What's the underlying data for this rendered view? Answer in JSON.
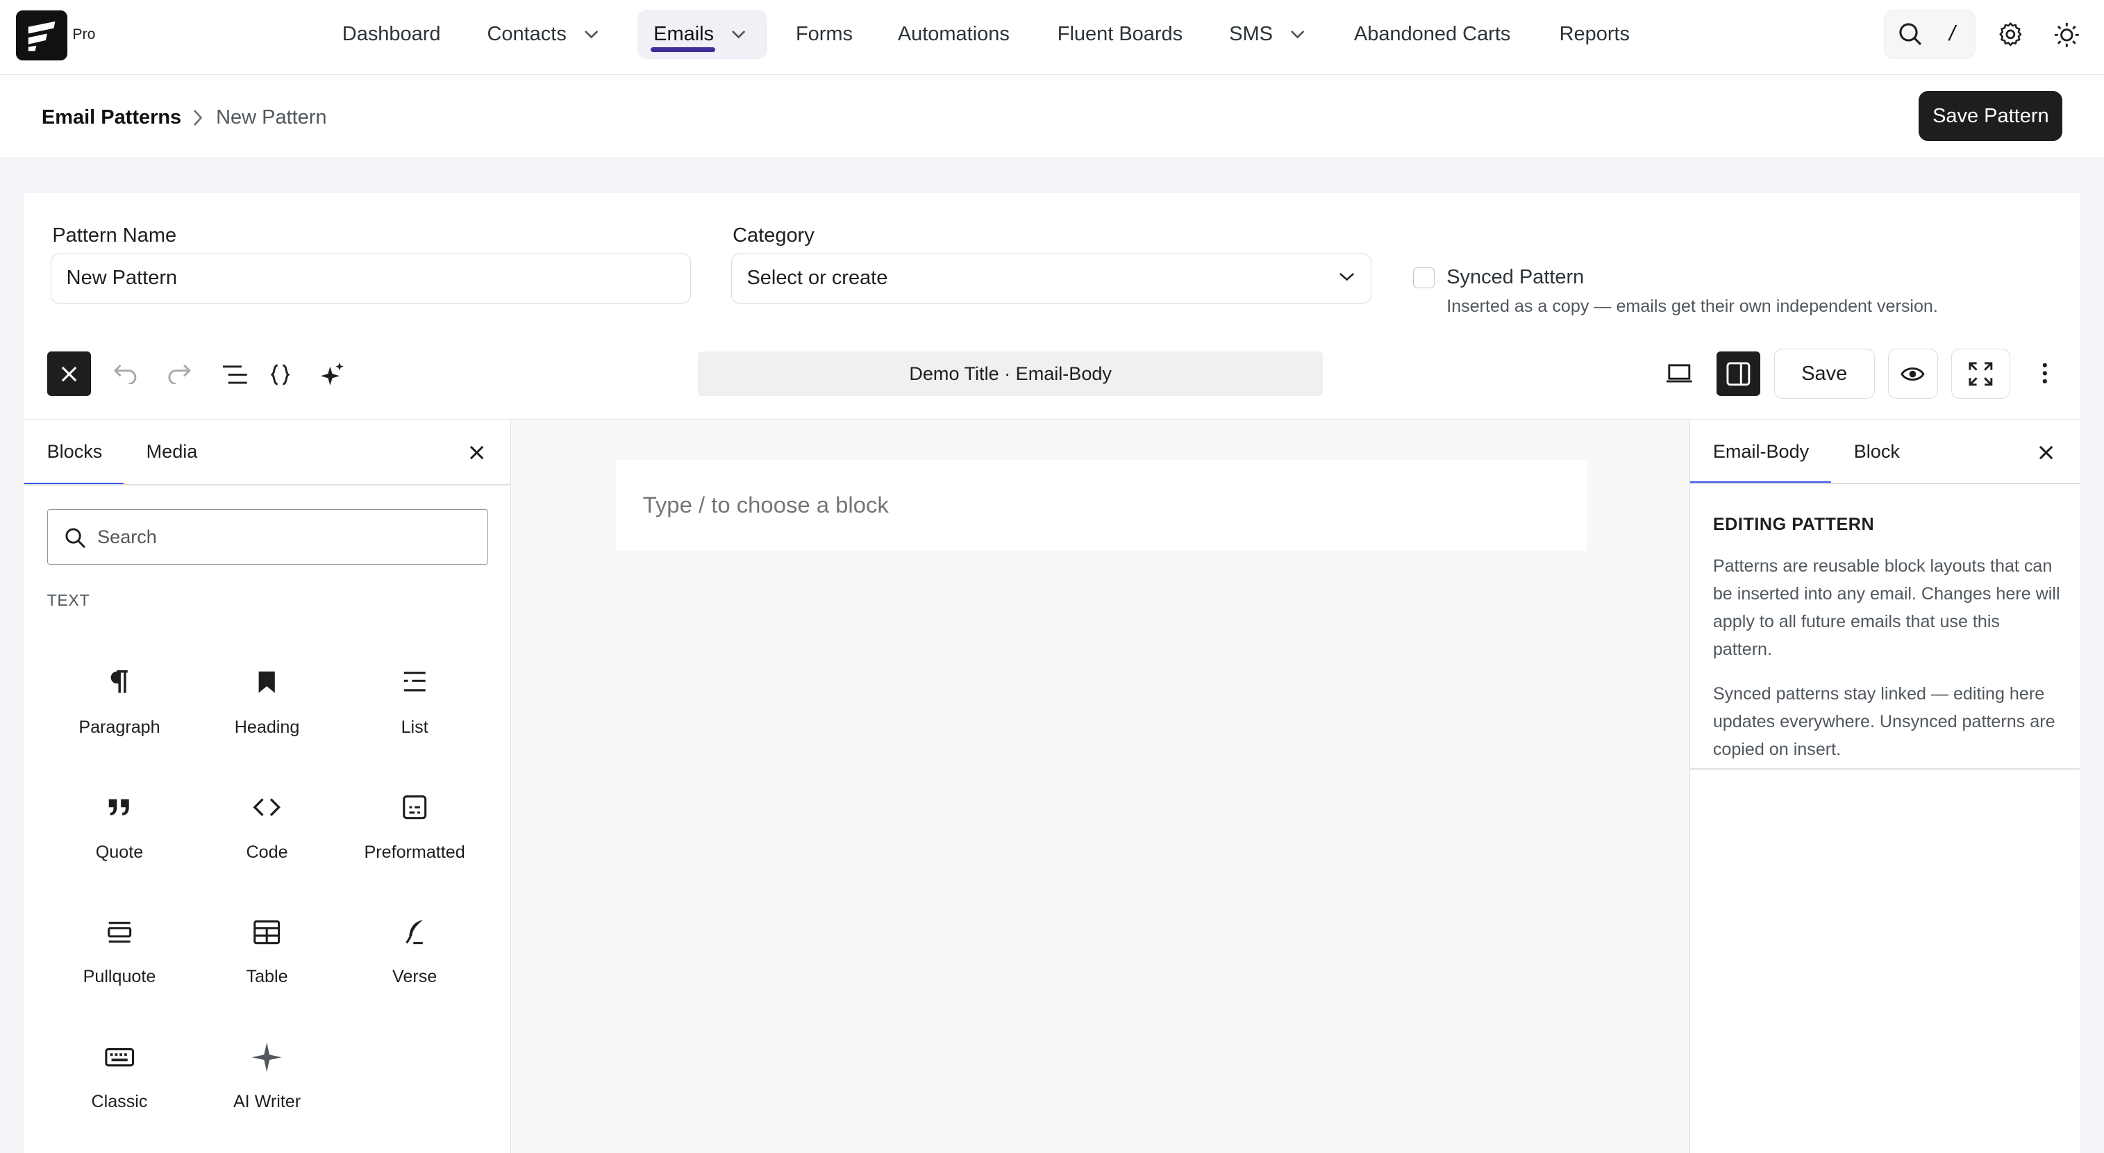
{
  "app": {
    "badge": "Pro"
  },
  "nav": {
    "dashboard": "Dashboard",
    "contacts": "Contacts",
    "emails": "Emails",
    "forms": "Forms",
    "automations": "Automations",
    "fluent_boards": "Fluent Boards",
    "sms": "SMS",
    "abandoned_carts": "Abandoned Carts",
    "reports": "Reports"
  },
  "search_shortcut": "/",
  "breadcrumb": {
    "root": "Email Patterns",
    "current": "New Pattern"
  },
  "save_pattern_label": "Save Pattern",
  "form": {
    "name_label": "Pattern Name",
    "name_value": "New Pattern",
    "category_label": "Category",
    "category_value": "Select or create",
    "synced_label": "Synced Pattern",
    "synced_desc": "Inserted as a copy — emails get their own independent version.",
    "synced_checked": false
  },
  "toolbar": {
    "document_title": "Demo Title · Email-Body",
    "save_label": "Save"
  },
  "inserter": {
    "tabs": [
      "Blocks",
      "Media"
    ],
    "search_placeholder": "Search",
    "category": "TEXT",
    "blocks": [
      {
        "label": "Paragraph",
        "icon": "paragraph-icon"
      },
      {
        "label": "Heading",
        "icon": "heading-icon"
      },
      {
        "label": "List",
        "icon": "list-icon"
      },
      {
        "label": "Quote",
        "icon": "quote-icon"
      },
      {
        "label": "Code",
        "icon": "code-icon"
      },
      {
        "label": "Preformatted",
        "icon": "preformatted-icon"
      },
      {
        "label": "Pullquote",
        "icon": "pullquote-icon"
      },
      {
        "label": "Table",
        "icon": "table-icon"
      },
      {
        "label": "Verse",
        "icon": "verse-icon"
      },
      {
        "label": "Classic",
        "icon": "classic-icon"
      },
      {
        "label": "AI Writer",
        "icon": "ai-writer-icon"
      }
    ]
  },
  "canvas": {
    "placeholder": "Type / to choose a block"
  },
  "sidebar": {
    "tabs": [
      "Email-Body",
      "Block"
    ],
    "title": "EDITING PATTERN",
    "p1": "Patterns are reusable block layouts that can be inserted into any email. Changes here will apply to all future emails that use this pattern.",
    "p2": "Synced patterns stay linked — editing here updates everywhere. Unsynced patterns are copied on insert."
  },
  "colors": {
    "accent": "#3858e9",
    "nav_active": "#3d2e9b",
    "dark": "#1e1e1e"
  }
}
